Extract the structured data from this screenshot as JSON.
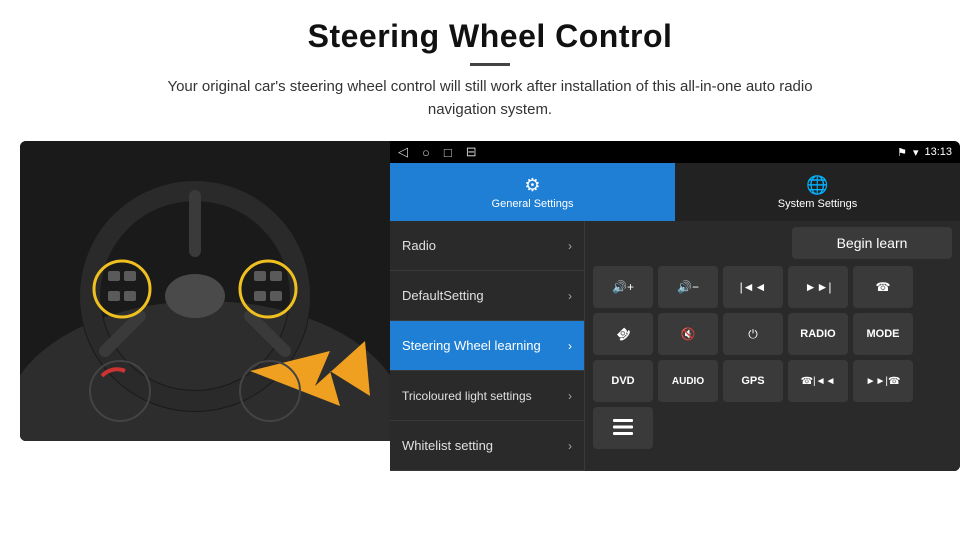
{
  "header": {
    "title": "Steering Wheel Control",
    "subtitle": "Your original car's steering wheel control will still work after installation of this all-in-one auto radio navigation system."
  },
  "status_bar": {
    "nav_icons": [
      "◁",
      "○",
      "□",
      "⊟"
    ],
    "time": "13:13",
    "signal_icons": [
      "⚑",
      "▾"
    ]
  },
  "tabs": [
    {
      "id": "general",
      "label": "General Settings",
      "active": true
    },
    {
      "id": "system",
      "label": "System Settings",
      "active": false
    }
  ],
  "menu_items": [
    {
      "id": "radio",
      "label": "Radio",
      "active": false
    },
    {
      "id": "default",
      "label": "DefaultSetting",
      "active": false
    },
    {
      "id": "steering",
      "label": "Steering Wheel learning",
      "active": true
    },
    {
      "id": "tricoloured",
      "label": "Tricoloured light settings",
      "active": false
    },
    {
      "id": "whitelist",
      "label": "Whitelist setting",
      "active": false
    }
  ],
  "controls": {
    "begin_learn_label": "Begin learn",
    "row1": [
      {
        "id": "vol-up",
        "icon": "🔊+",
        "text": "◄◄+"
      },
      {
        "id": "vol-down",
        "icon": "🔊-",
        "text": "◄◄-"
      },
      {
        "id": "prev-track",
        "icon": "|◄◄",
        "text": "|◄◄"
      },
      {
        "id": "next-track",
        "icon": "►►|",
        "text": "►►|"
      },
      {
        "id": "phone",
        "icon": "☎",
        "text": "☎"
      }
    ],
    "row2": [
      {
        "id": "hang-up",
        "icon": "✆",
        "text": "✆"
      },
      {
        "id": "mute",
        "icon": "🔇",
        "text": "🔇"
      },
      {
        "id": "power",
        "icon": "⏻",
        "text": "⏻"
      },
      {
        "id": "radio-btn",
        "icon": "RADIO",
        "text": "RADIO"
      },
      {
        "id": "mode",
        "icon": "MODE",
        "text": "MODE"
      }
    ],
    "row3": [
      {
        "id": "dvd",
        "icon": "DVD",
        "text": "DVD"
      },
      {
        "id": "audio",
        "icon": "AUDIO",
        "text": "AUDIO"
      },
      {
        "id": "gps",
        "icon": "GPS",
        "text": "GPS"
      },
      {
        "id": "phone2",
        "icon": "☎|◄◄",
        "text": "☎|◄◄"
      },
      {
        "id": "skip",
        "icon": "►►|☎",
        "text": "►►|☎"
      }
    ],
    "row4": [
      {
        "id": "menu-btn",
        "icon": "☰",
        "text": "☰"
      }
    ]
  }
}
